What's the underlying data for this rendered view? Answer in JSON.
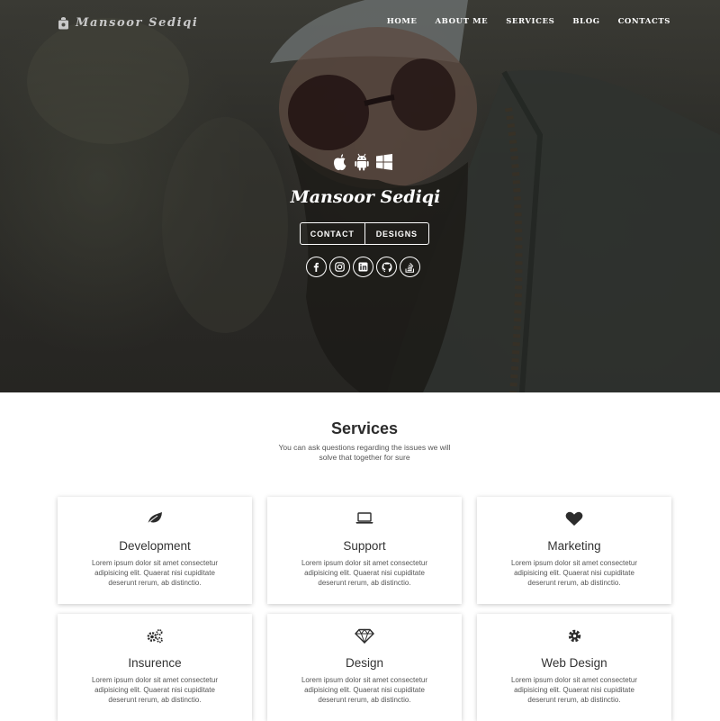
{
  "header": {
    "logo_text": "Mansoor Sediqi",
    "nav": [
      {
        "label": "HOME"
      },
      {
        "label": "ABOUT ME"
      },
      {
        "label": "SERVICES"
      },
      {
        "label": "BLOG"
      },
      {
        "label": "CONTACTS"
      }
    ]
  },
  "hero": {
    "platform_icons": [
      "apple-icon",
      "android-icon",
      "windows-icon"
    ],
    "name": "Mansoor Sediqi",
    "buttons": {
      "contact": "CONTACT",
      "designs": "DESIGNS"
    },
    "socials": [
      "facebook-icon",
      "instagram-icon",
      "linkedin-icon",
      "github-icon",
      "stackoverflow-icon"
    ]
  },
  "services": {
    "title": "Services",
    "subtitle": "You can ask questions regarding the issues we will solve that together for sure",
    "cards": [
      {
        "icon": "leaf-icon",
        "title": "Development",
        "text": "Lorem ipsum dolor sit amet consectetur adipisicing elit. Quaerat nisi cupiditate deserunt rerum, ab distinctio."
      },
      {
        "icon": "laptop-icon",
        "title": "Support",
        "text": "Lorem ipsum dolor sit amet consectetur adipisicing elit. Quaerat nisi cupiditate deserunt rerum, ab distinctio."
      },
      {
        "icon": "heart-icon",
        "title": "Marketing",
        "text": "Lorem ipsum dolor sit amet consectetur adipisicing elit. Quaerat nisi cupiditate deserunt rerum, ab distinctio."
      },
      {
        "icon": "cogs-icon",
        "title": "Insurence",
        "text": "Lorem ipsum dolor sit amet consectetur adipisicing elit. Quaerat nisi cupiditate deserunt rerum, ab distinctio."
      },
      {
        "icon": "diamond-icon",
        "title": "Design",
        "text": "Lorem ipsum dolor sit amet consectetur adipisicing elit. Quaerat nisi cupiditate deserunt rerum, ab distinctio."
      },
      {
        "icon": "gear-icon",
        "title": "Web Design",
        "text": "Lorem ipsum dolor sit amet consectetur adipisicing elit. Quaerat nisi cupiditate deserunt rerum, ab distinctio."
      }
    ]
  },
  "colors": {
    "hero_overlay": "#2a2a26",
    "text_dark": "#333333",
    "text_muted": "#555555",
    "white": "#ffffff"
  }
}
